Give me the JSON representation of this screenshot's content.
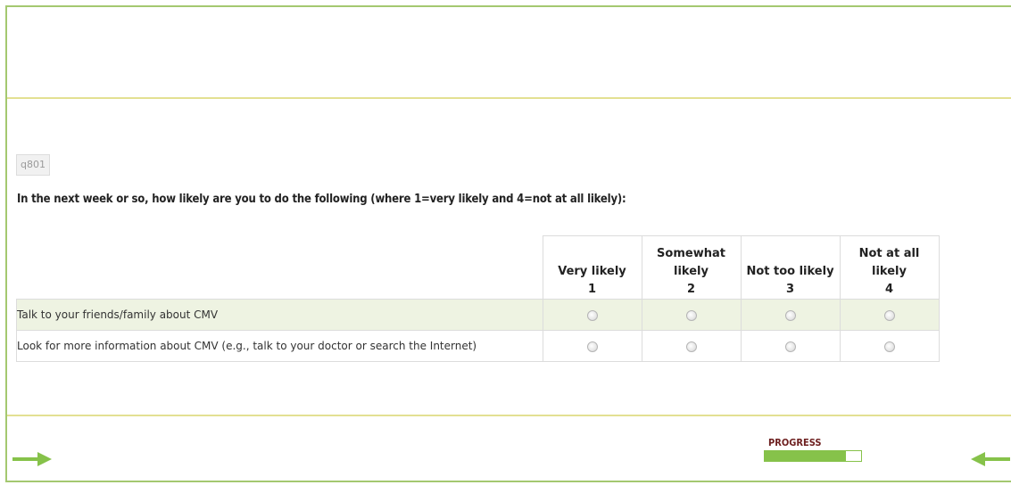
{
  "question": {
    "id": "q801",
    "text": "In the next week or so, how likely are you to do the following (where 1=very likely and 4=not at all likely):"
  },
  "columns": [
    {
      "label": "Very likely",
      "value": "1"
    },
    {
      "label": "Somewhat likely",
      "value": "2"
    },
    {
      "label": "Not too likely",
      "value": "3"
    },
    {
      "label": "Not at all likely",
      "value": "4"
    }
  ],
  "rows": [
    {
      "label": "Talk to your friends/family about CMV"
    },
    {
      "label": "Look for more information about CMV (e.g., talk to your doctor or search the Internet)"
    }
  ],
  "navigation": {
    "next_icon": "arrow-right-icon",
    "back_icon": "arrow-left-icon"
  },
  "progress": {
    "label": "PROGRESS",
    "fraction": 0.84
  },
  "colors": {
    "accent": "#86c24a",
    "border": "#a4c870",
    "divider": "#e3e092",
    "row_alt": "#eef3e2",
    "progress_label": "#6d1f1f"
  }
}
